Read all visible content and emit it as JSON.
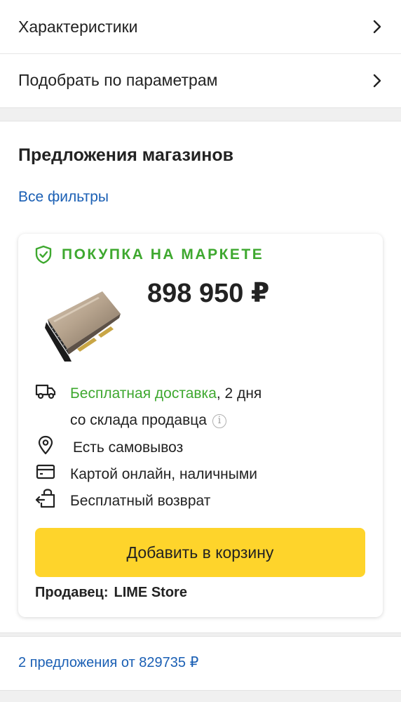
{
  "nav": {
    "items": [
      {
        "label": "Характеристики"
      },
      {
        "label": "Подобрать по параметрам"
      }
    ]
  },
  "offers": {
    "title": "Предложения магазинов",
    "filters_link": "Все фильтры",
    "card": {
      "badge": "ПОКУПКА НА МАРКЕТЕ",
      "price": "898 950 ₽",
      "delivery_free": "Бесплатная доставка",
      "delivery_days": ", 2 дня",
      "delivery_source": "со склада продавца",
      "pickup": "Есть самовывоз",
      "payment": "Картой онлайн, наличными",
      "return": "Бесплатный возврат",
      "add_to_cart": "Добавить в корзину",
      "seller_label": "Продавец:",
      "seller_name": "LIME Store",
      "info_glyph": "i"
    },
    "more_offers": "2 предложения от 829735 ₽"
  },
  "colors": {
    "accent_green": "#3ea82f",
    "link_blue": "#1a5fb4",
    "button_yellow": "#fed42b"
  },
  "icons": [
    "chevron-right-icon",
    "shield-check-icon",
    "truck-icon",
    "location-pin-icon",
    "card-icon",
    "return-icon",
    "info-icon"
  ]
}
